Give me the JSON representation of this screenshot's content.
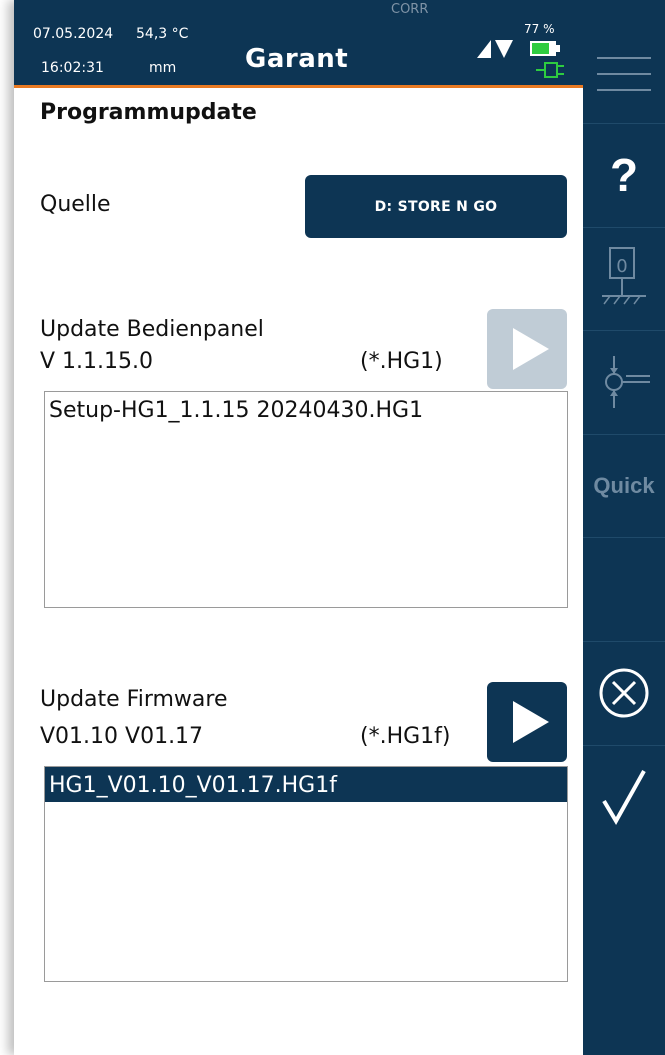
{
  "header": {
    "date": "07.05.2024",
    "time": "16:02:31",
    "temperature": "54,3 °C",
    "unit": "mm",
    "brand": "Garant",
    "corr": "CORR",
    "battery_percent": "77 %",
    "battery_color": "#2ecc40"
  },
  "page": {
    "title": "Programmupdate"
  },
  "source": {
    "label": "Quelle",
    "button_label": "D:  STORE N GO"
  },
  "panel_update": {
    "title": "Update Bedienpanel",
    "version": "V 1.1.15.0",
    "filter": "(*.HG1)",
    "files": [
      "Setup-HG1_1.1.15 20240430.HG1"
    ]
  },
  "firmware_update": {
    "title": "Update Firmware",
    "version": "V01.10  V01.17",
    "filter": "(*.HG1f)",
    "files": [
      "HG1_V01.10_V01.17.HG1f"
    ]
  },
  "sidebar": {
    "items": [
      {
        "icon": "menu-icon"
      },
      {
        "icon": "help-icon",
        "label": "?"
      },
      {
        "icon": "zero-tare-icon",
        "label": "0"
      },
      {
        "icon": "probe-icon"
      },
      {
        "icon": "quick-icon",
        "label": "Quick"
      },
      {
        "icon": "blank"
      },
      {
        "icon": "cancel-icon"
      },
      {
        "icon": "confirm-icon"
      }
    ]
  },
  "colors": {
    "primary": "#0d3554",
    "accent": "#e97a22",
    "disabled": "#c0ccd6"
  }
}
